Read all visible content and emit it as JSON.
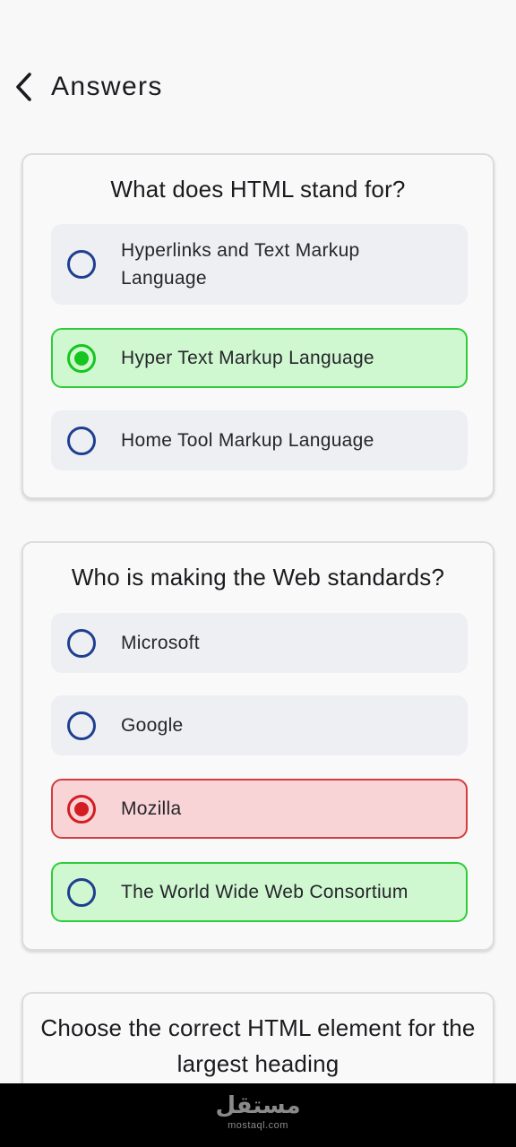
{
  "header": {
    "title": "Answers"
  },
  "questions": [
    {
      "text": "What does HTML stand for?",
      "options": [
        {
          "label": "Hyperlinks and Text Markup Language",
          "state": "default"
        },
        {
          "label": "Hyper Text Markup Language",
          "state": "correct-selected"
        },
        {
          "label": "Home Tool Markup Language",
          "state": "default"
        }
      ]
    },
    {
      "text": "Who is making the Web standards?",
      "options": [
        {
          "label": "Microsoft",
          "state": "default"
        },
        {
          "label": "Google",
          "state": "default"
        },
        {
          "label": "Mozilla",
          "state": "wrong-selected"
        },
        {
          "label": "The World Wide Web Consortium",
          "state": "correct"
        }
      ]
    },
    {
      "text": "Choose the correct HTML element for the largest heading",
      "options": []
    }
  ],
  "watermark": {
    "arabic": "مستقل",
    "latin": "mostaql.com"
  },
  "colors": {
    "correct_bg": "#d0f8d0",
    "correct_border": "#2fcc3a",
    "wrong_bg": "#f9d4d6",
    "wrong_border": "#d23d3f",
    "radio_default": "#1e3f90",
    "option_bg": "#eeeff3"
  },
  "icons": {
    "back": "chevron-left-icon"
  }
}
